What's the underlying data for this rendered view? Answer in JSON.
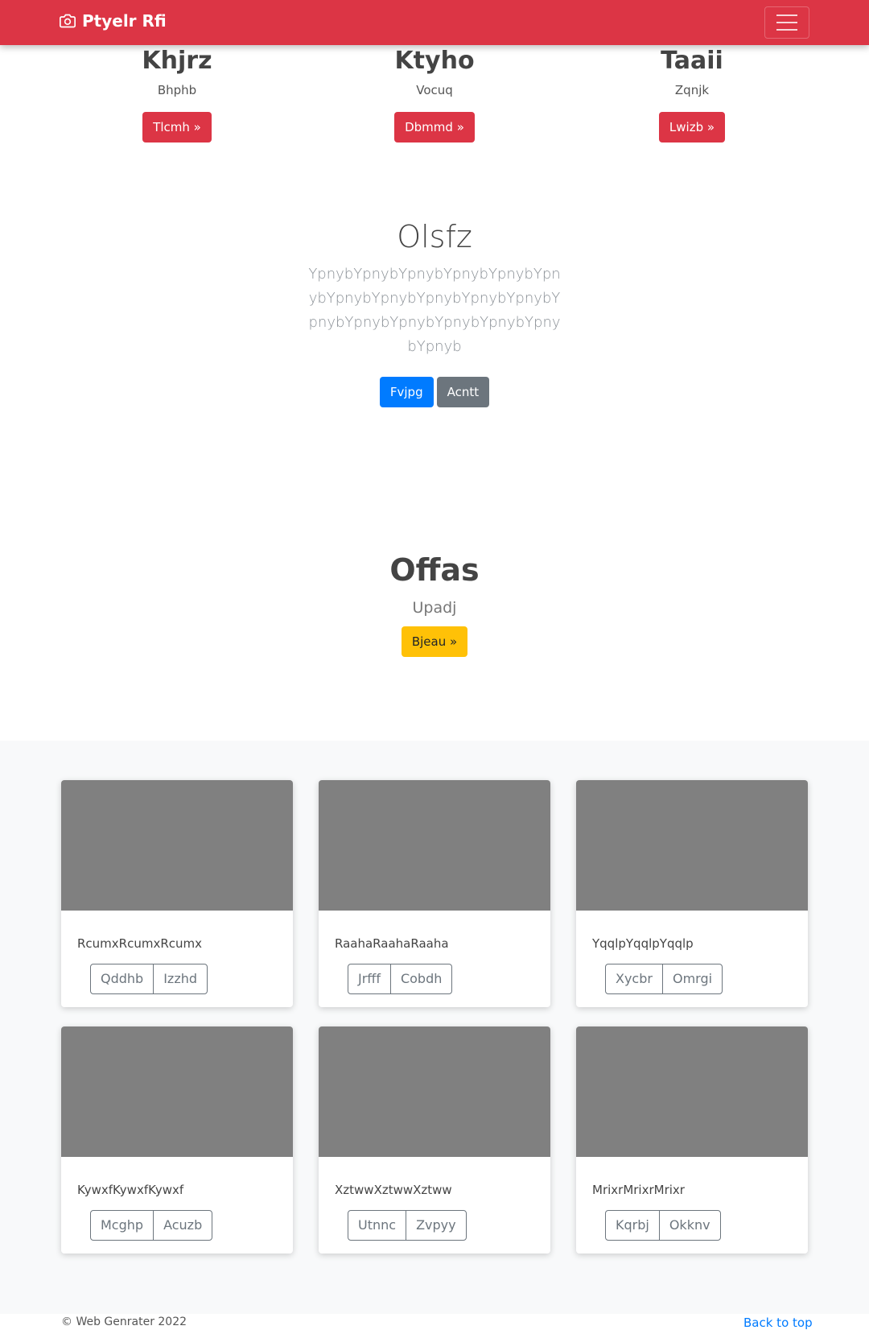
{
  "navbar": {
    "brand": "Ptyelr Rfi",
    "brand_icon": "camera-icon",
    "menu_icon": "hamburger-menu-icon"
  },
  "features": [
    {
      "title": "Khjrz",
      "subtitle": "Bhphb",
      "button": "Tlcmh »"
    },
    {
      "title": "Ktyho",
      "subtitle": "Vocuq",
      "button": "Dbmmd »"
    },
    {
      "title": "Taaii",
      "subtitle": "Zqnjk",
      "button": "Lwizb »"
    }
  ],
  "jumbotron": {
    "title": "Olsfz",
    "lead": "YpnybYpnybYpnybYpnybYpnybYpnybYpnybYpnybYpnybYpnybYpnybYpnybYpnybYpnybYpnybYpnybYpnybYpnyb",
    "primary_button": "Fvjpg",
    "secondary_button": "Acntt"
  },
  "offer": {
    "title": "Offas",
    "subtitle": "Upadj",
    "button": "Bjeau »"
  },
  "cards": [
    {
      "text": "RcumxRcumxRcumx",
      "btn1": "Qddhb",
      "btn2": "Izzhd"
    },
    {
      "text": "RaahaRaahaRaaha",
      "btn1": "Jrfff",
      "btn2": "Cobdh"
    },
    {
      "text": "YqqlpYqqlpYqqlp",
      "btn1": "Xycbr",
      "btn2": "Omrgi"
    },
    {
      "text": "KywxfKywxfKywxf",
      "btn1": "Mcghp",
      "btn2": "Acuzb"
    },
    {
      "text": "XztwwXztwwXztww",
      "btn1": "Utnnc",
      "btn2": "Zvpyy"
    },
    {
      "text": "MrixrMrixrMrixr",
      "btn1": "Kqrbj",
      "btn2": "Okknv"
    }
  ],
  "footer": {
    "copyright": "© Web Genrater 2022",
    "back_to_top": "Back to top"
  },
  "colors": {
    "navbar": "#dc3545",
    "primary": "#007bff",
    "secondary": "#6c757d",
    "warning": "#ffc107",
    "thumbnail": "#808080"
  }
}
